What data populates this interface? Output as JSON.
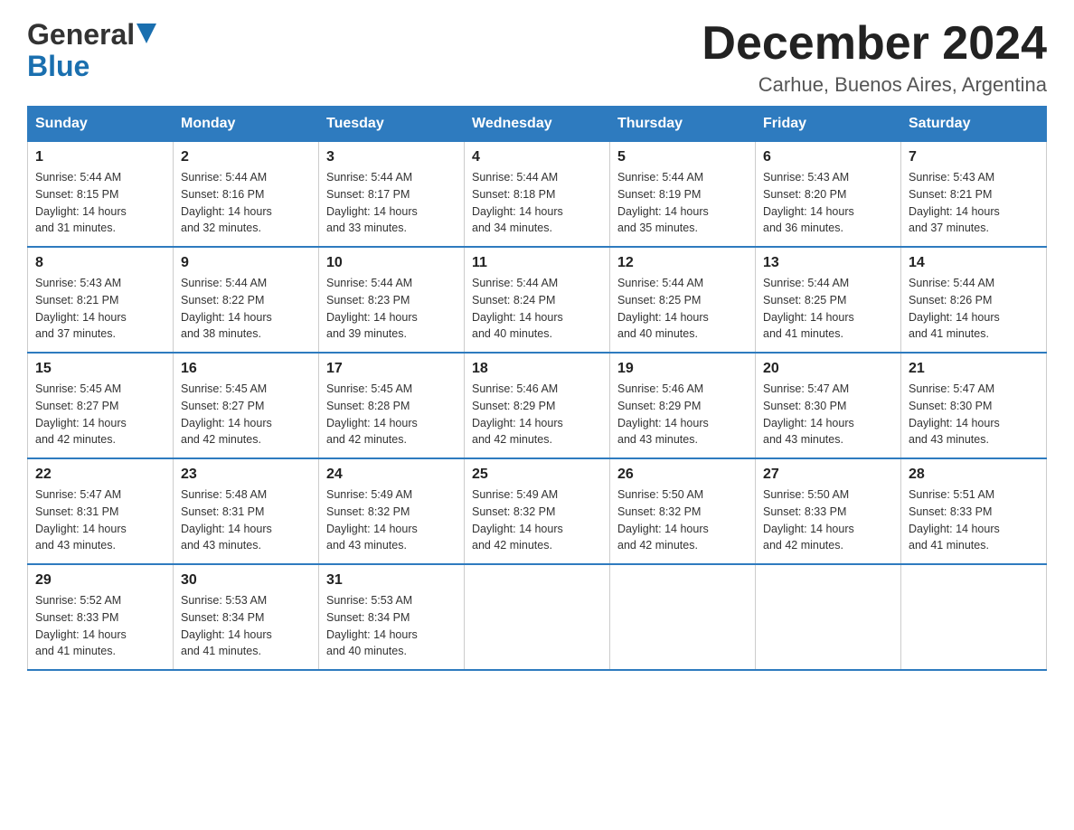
{
  "header": {
    "logo_line1": "General",
    "logo_line2": "Blue",
    "month_title": "December 2024",
    "location": "Carhue, Buenos Aires, Argentina"
  },
  "days_of_week": [
    "Sunday",
    "Monday",
    "Tuesday",
    "Wednesday",
    "Thursday",
    "Friday",
    "Saturday"
  ],
  "weeks": [
    [
      {
        "day": "1",
        "sunrise": "5:44 AM",
        "sunset": "8:15 PM",
        "daylight": "14 hours and 31 minutes."
      },
      {
        "day": "2",
        "sunrise": "5:44 AM",
        "sunset": "8:16 PM",
        "daylight": "14 hours and 32 minutes."
      },
      {
        "day": "3",
        "sunrise": "5:44 AM",
        "sunset": "8:17 PM",
        "daylight": "14 hours and 33 minutes."
      },
      {
        "day": "4",
        "sunrise": "5:44 AM",
        "sunset": "8:18 PM",
        "daylight": "14 hours and 34 minutes."
      },
      {
        "day": "5",
        "sunrise": "5:44 AM",
        "sunset": "8:19 PM",
        "daylight": "14 hours and 35 minutes."
      },
      {
        "day": "6",
        "sunrise": "5:43 AM",
        "sunset": "8:20 PM",
        "daylight": "14 hours and 36 minutes."
      },
      {
        "day": "7",
        "sunrise": "5:43 AM",
        "sunset": "8:21 PM",
        "daylight": "14 hours and 37 minutes."
      }
    ],
    [
      {
        "day": "8",
        "sunrise": "5:43 AM",
        "sunset": "8:21 PM",
        "daylight": "14 hours and 37 minutes."
      },
      {
        "day": "9",
        "sunrise": "5:44 AM",
        "sunset": "8:22 PM",
        "daylight": "14 hours and 38 minutes."
      },
      {
        "day": "10",
        "sunrise": "5:44 AM",
        "sunset": "8:23 PM",
        "daylight": "14 hours and 39 minutes."
      },
      {
        "day": "11",
        "sunrise": "5:44 AM",
        "sunset": "8:24 PM",
        "daylight": "14 hours and 40 minutes."
      },
      {
        "day": "12",
        "sunrise": "5:44 AM",
        "sunset": "8:25 PM",
        "daylight": "14 hours and 40 minutes."
      },
      {
        "day": "13",
        "sunrise": "5:44 AM",
        "sunset": "8:25 PM",
        "daylight": "14 hours and 41 minutes."
      },
      {
        "day": "14",
        "sunrise": "5:44 AM",
        "sunset": "8:26 PM",
        "daylight": "14 hours and 41 minutes."
      }
    ],
    [
      {
        "day": "15",
        "sunrise": "5:45 AM",
        "sunset": "8:27 PM",
        "daylight": "14 hours and 42 minutes."
      },
      {
        "day": "16",
        "sunrise": "5:45 AM",
        "sunset": "8:27 PM",
        "daylight": "14 hours and 42 minutes."
      },
      {
        "day": "17",
        "sunrise": "5:45 AM",
        "sunset": "8:28 PM",
        "daylight": "14 hours and 42 minutes."
      },
      {
        "day": "18",
        "sunrise": "5:46 AM",
        "sunset": "8:29 PM",
        "daylight": "14 hours and 42 minutes."
      },
      {
        "day": "19",
        "sunrise": "5:46 AM",
        "sunset": "8:29 PM",
        "daylight": "14 hours and 43 minutes."
      },
      {
        "day": "20",
        "sunrise": "5:47 AM",
        "sunset": "8:30 PM",
        "daylight": "14 hours and 43 minutes."
      },
      {
        "day": "21",
        "sunrise": "5:47 AM",
        "sunset": "8:30 PM",
        "daylight": "14 hours and 43 minutes."
      }
    ],
    [
      {
        "day": "22",
        "sunrise": "5:47 AM",
        "sunset": "8:31 PM",
        "daylight": "14 hours and 43 minutes."
      },
      {
        "day": "23",
        "sunrise": "5:48 AM",
        "sunset": "8:31 PM",
        "daylight": "14 hours and 43 minutes."
      },
      {
        "day": "24",
        "sunrise": "5:49 AM",
        "sunset": "8:32 PM",
        "daylight": "14 hours and 43 minutes."
      },
      {
        "day": "25",
        "sunrise": "5:49 AM",
        "sunset": "8:32 PM",
        "daylight": "14 hours and 42 minutes."
      },
      {
        "day": "26",
        "sunrise": "5:50 AM",
        "sunset": "8:32 PM",
        "daylight": "14 hours and 42 minutes."
      },
      {
        "day": "27",
        "sunrise": "5:50 AM",
        "sunset": "8:33 PM",
        "daylight": "14 hours and 42 minutes."
      },
      {
        "day": "28",
        "sunrise": "5:51 AM",
        "sunset": "8:33 PM",
        "daylight": "14 hours and 41 minutes."
      }
    ],
    [
      {
        "day": "29",
        "sunrise": "5:52 AM",
        "sunset": "8:33 PM",
        "daylight": "14 hours and 41 minutes."
      },
      {
        "day": "30",
        "sunrise": "5:53 AM",
        "sunset": "8:34 PM",
        "daylight": "14 hours and 41 minutes."
      },
      {
        "day": "31",
        "sunrise": "5:53 AM",
        "sunset": "8:34 PM",
        "daylight": "14 hours and 40 minutes."
      },
      null,
      null,
      null,
      null
    ]
  ],
  "labels": {
    "sunrise": "Sunrise:",
    "sunset": "Sunset:",
    "daylight": "Daylight:"
  }
}
